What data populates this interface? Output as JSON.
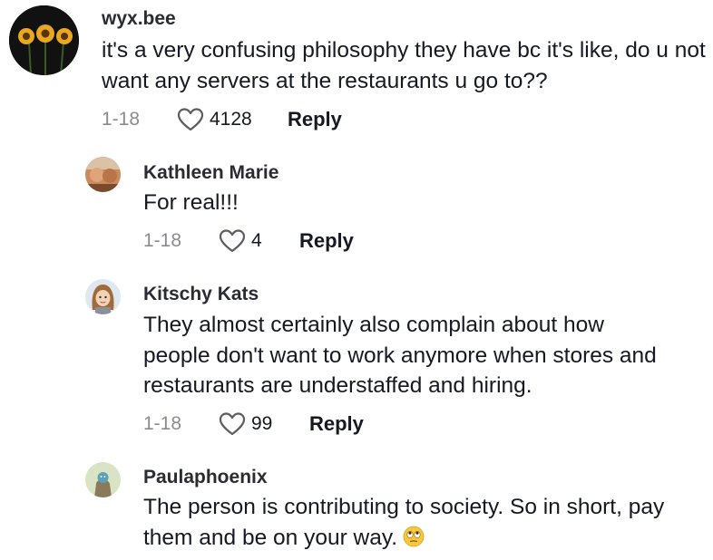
{
  "comments": [
    {
      "username": "wyx.bee",
      "text": "it's a very confusing philosophy they have bc it's like, do u not want any servers at the restaurants u go to??",
      "date": "1-18",
      "likes": "4128",
      "reply_label": "Reply"
    },
    {
      "username": "Kathleen Marie",
      "text": "For real!!!",
      "date": "1-18",
      "likes": "4",
      "reply_label": "Reply"
    },
    {
      "username": "Kitschy Kats",
      "text": "They almost certainly also complain about how people don't want to work anymore when stores and restaurants are understaffed and hiring.",
      "date": "1-18",
      "likes": "99",
      "reply_label": "Reply"
    },
    {
      "username": "Paulaphoenix",
      "text": "The person is contributing to society. So in short, pay them and be on your way.",
      "emoji": "rolling-eyes-emoji"
    }
  ]
}
